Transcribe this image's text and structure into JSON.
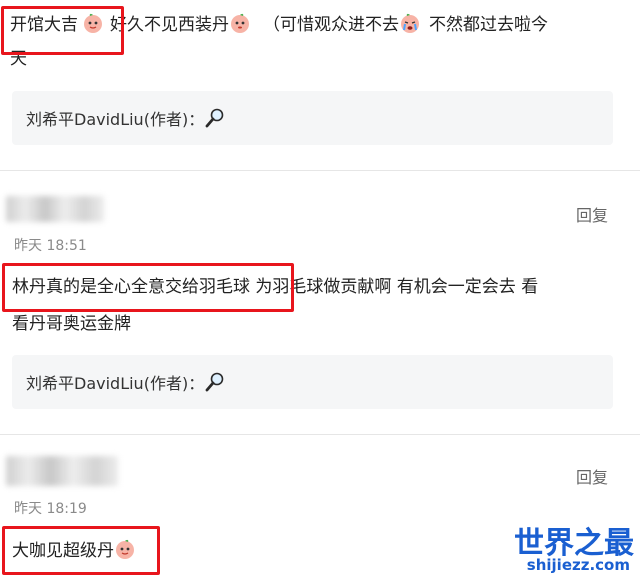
{
  "comments": [
    {
      "text_part1": "开馆大吉",
      "text_part2": "好久不见西装丹",
      "text_part3": "（可惜观众进不去",
      "text_part4": "不然都过去啦今",
      "text_line2": "天",
      "reply": {
        "author": "刘希平DavidLiu(作者)",
        "separator": "："
      }
    },
    {
      "time": "昨天 18:51",
      "reply_label": "回复",
      "text_line1": "林丹真的是全心全意交给羽毛球 为羽毛球做贡献啊 有机会一定会去 看",
      "text_line2": "看丹哥奥运金牌",
      "reply": {
        "author": "刘希平DavidLiu(作者)",
        "separator": "："
      }
    },
    {
      "time": "昨天 18:19",
      "reply_label": "回复",
      "text_line1": "大咖见超级丹"
    }
  ],
  "watermark": {
    "title": "世界之最",
    "url": "shijiezz.com"
  },
  "colors": {
    "highlight": "#e8151c",
    "watermark": "#1a5fd1"
  },
  "icons": [
    "peach-emoji-icon",
    "crying-emoji-icon",
    "magnifier-icon"
  ]
}
